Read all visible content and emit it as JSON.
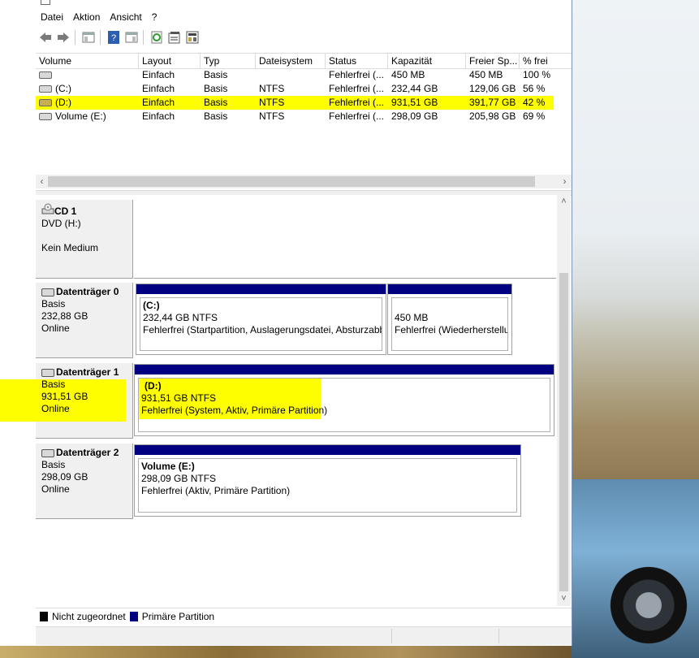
{
  "menu": [
    "Datei",
    "Aktion",
    "Ansicht",
    "?"
  ],
  "toolbar": {
    "icons": [
      "back-arrow-icon",
      "forward-arrow-icon",
      "console-tree-icon",
      "help-icon",
      "properties-list-icon",
      "refresh-icon",
      "properties-icon",
      "rescan-disks-icon"
    ]
  },
  "volume_list": {
    "columns": [
      "Volume",
      "Layout",
      "Typ",
      "Dateisystem",
      "Status",
      "Kapazität",
      "Freier Sp...",
      "% frei"
    ],
    "rows": [
      {
        "volume": "",
        "layout": "Einfach",
        "typ": "Basis",
        "fs": "",
        "status": "Fehlerfrei (...",
        "cap": "450 MB",
        "free": "450 MB",
        "pct": "100 %"
      },
      {
        "volume": "(C:)",
        "layout": "Einfach",
        "typ": "Basis",
        "fs": "NTFS",
        "status": "Fehlerfrei (...",
        "cap": "232,44 GB",
        "free": "129,06 GB",
        "pct": "56 %"
      },
      {
        "volume": "(D:)",
        "layout": "Einfach",
        "typ": "Basis",
        "fs": "NTFS",
        "status": "Fehlerfrei (...",
        "cap": "931,51 GB",
        "free": "391,77 GB",
        "pct": "42 %"
      },
      {
        "volume": "Volume (E:)",
        "layout": "Einfach",
        "typ": "Basis",
        "fs": "NTFS",
        "status": "Fehlerfrei (...",
        "cap": "298,09 GB",
        "free": "205,98 GB",
        "pct": "69 %"
      }
    ]
  },
  "disks": {
    "cd1": {
      "name": "CD 1",
      "line1": "DVD (H:)",
      "line2": "",
      "line3": "Kein Medium"
    },
    "disk0": {
      "name": "Datenträger 0",
      "type": "Basis",
      "size": "232,88 GB",
      "state": "Online",
      "p1": {
        "name": "(C:)",
        "size": "232,44 GB NTFS",
        "status": "Fehlerfrei (Startpartition, Auslagerungsdatei, Absturzabb"
      },
      "p2": {
        "name": "",
        "size": "450 MB",
        "status": "Fehlerfrei (Wiederherstellu"
      }
    },
    "disk1": {
      "name": "Datenträger 1",
      "type": "Basis",
      "size": "931,51 GB",
      "state": "Online",
      "p1": {
        "name": "(D:)",
        "size": "931,51 GB NTFS",
        "status": "Fehlerfrei (System, Aktiv, Primäre Partition)"
      }
    },
    "disk2": {
      "name": "Datenträger 2",
      "type": "Basis",
      "size": "298,09 GB",
      "state": "Online",
      "p1": {
        "name": "Volume  (E:)",
        "size": "298,09 GB NTFS",
        "status": "Fehlerfrei (Aktiv, Primäre Partition)"
      }
    }
  },
  "legend": [
    {
      "label": "Nicht zugeordnet",
      "color": "#000000"
    },
    {
      "label": "Primäre Partition",
      "color": "#000080"
    }
  ],
  "colors": {
    "highlight": "#fefe00",
    "primary": "#000080",
    "unallocated": "#000000"
  }
}
